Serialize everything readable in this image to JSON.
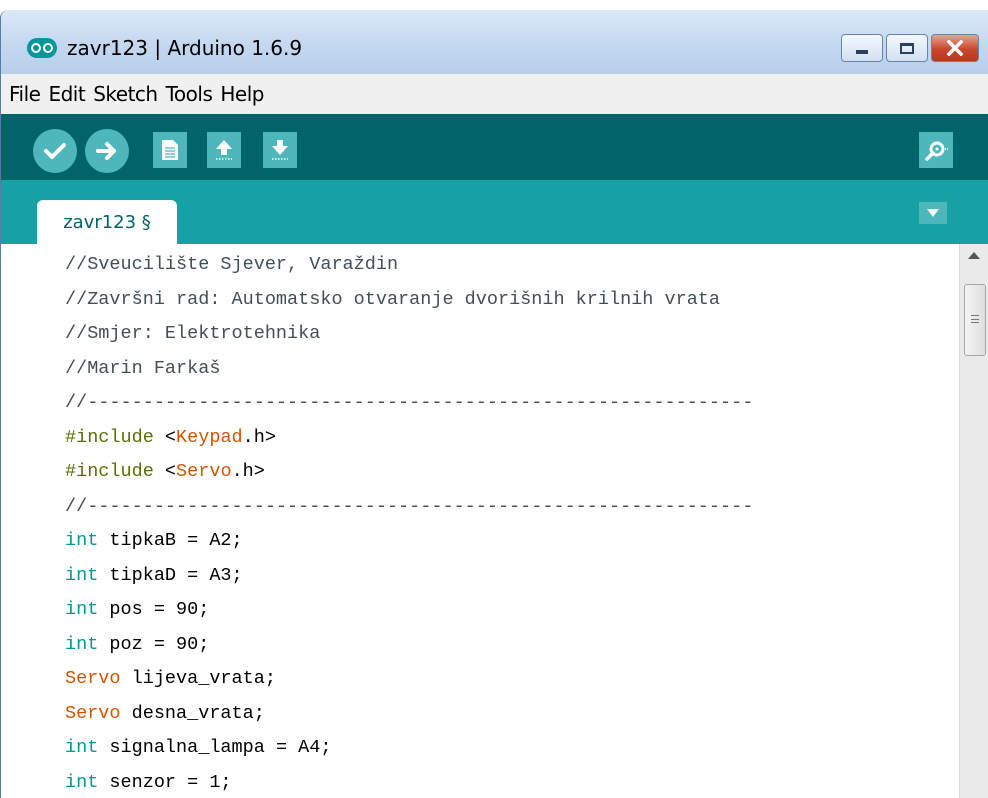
{
  "window": {
    "title": "zavr123 | Arduino 1.6.9"
  },
  "menu": [
    "File",
    "Edit",
    "Sketch",
    "Tools",
    "Help"
  ],
  "toolbar": {
    "icons": [
      "verify-icon",
      "upload-icon",
      "new-icon",
      "open-icon",
      "save-icon",
      "serial-monitor-icon"
    ]
  },
  "tabs": [
    {
      "label": "zavr123 §"
    }
  ],
  "colors": {
    "toolbar_bg": "#006468",
    "tabbar_bg": "#17a1a5",
    "button_bg": "#4db7bb",
    "keyword": "#00979c",
    "class": "#d35400",
    "preprocessor": "#5e6d03",
    "comment": "#434f54"
  },
  "code": {
    "lines": [
      [
        {
          "t": "//Sveucilište Sjever, Varaždin",
          "k": "comment"
        }
      ],
      [
        {
          "t": "//Završni rad: Automatsko otvaranje dvorišnih krilnih vrata",
          "k": "comment"
        }
      ],
      [
        {
          "t": "//Smjer: Elektrotehnika",
          "k": "comment"
        }
      ],
      [
        {
          "t": "//Marin Farkaš",
          "k": "comment"
        }
      ],
      [
        {
          "t": "//------------------------------------------------------------",
          "k": "comment"
        }
      ],
      [
        {
          "t": "#include",
          "k": "pre"
        },
        {
          "t": " <",
          "k": "plain"
        },
        {
          "t": "Keypad",
          "k": "lib"
        },
        {
          "t": ".h>",
          "k": "plain"
        }
      ],
      [
        {
          "t": "#include",
          "k": "pre"
        },
        {
          "t": " <",
          "k": "plain"
        },
        {
          "t": "Servo",
          "k": "lib"
        },
        {
          "t": ".h>",
          "k": "plain"
        }
      ],
      [
        {
          "t": "//------------------------------------------------------------",
          "k": "comment"
        }
      ],
      [
        {
          "t": "int",
          "k": "type"
        },
        {
          "t": " tipkaB = A2;",
          "k": "plain"
        }
      ],
      [
        {
          "t": "int",
          "k": "type"
        },
        {
          "t": " tipkaD = A3;",
          "k": "plain"
        }
      ],
      [
        {
          "t": "int",
          "k": "type"
        },
        {
          "t": " pos = 90;",
          "k": "plain"
        }
      ],
      [
        {
          "t": "int",
          "k": "type"
        },
        {
          "t": " poz = 90;",
          "k": "plain"
        }
      ],
      [
        {
          "t": "Servo",
          "k": "class"
        },
        {
          "t": " lijeva_vrata;",
          "k": "plain"
        }
      ],
      [
        {
          "t": "Servo",
          "k": "class"
        },
        {
          "t": " desna_vrata;",
          "k": "plain"
        }
      ],
      [
        {
          "t": "int",
          "k": "type"
        },
        {
          "t": " signalna_lampa = A4;",
          "k": "plain"
        }
      ],
      [
        {
          "t": "int",
          "k": "type"
        },
        {
          "t": " senzor = 1;",
          "k": "plain"
        }
      ],
      [
        {
          "t": "//",
          "k": "comment"
        }
      ]
    ]
  }
}
